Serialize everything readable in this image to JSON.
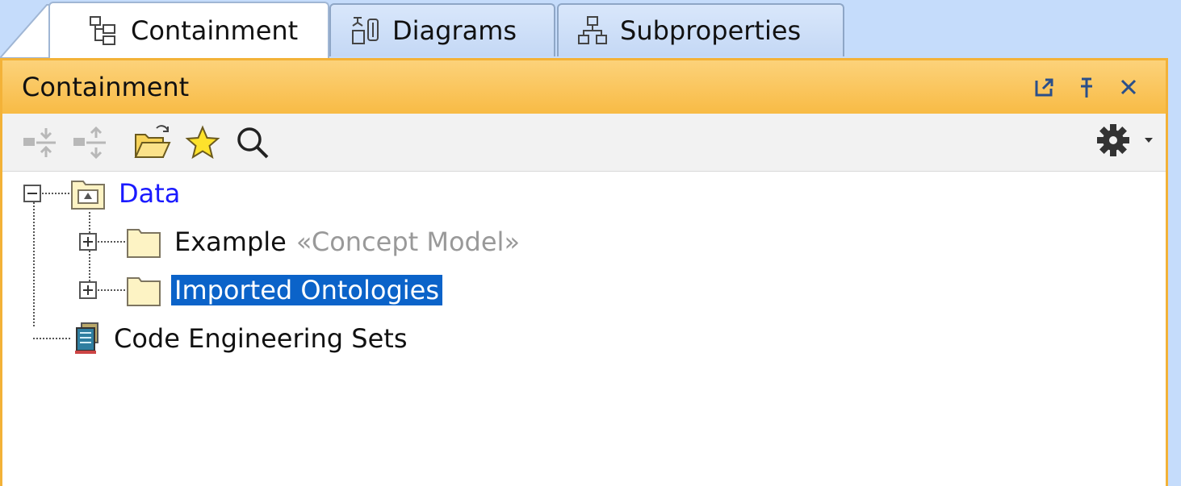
{
  "tabs": [
    {
      "label": "Containment",
      "icon": "containment-tree-icon",
      "active": true
    },
    {
      "label": "Diagrams",
      "icon": "diagram-icon",
      "active": false
    },
    {
      "label": "Subproperties",
      "icon": "hierarchy-icon",
      "active": false
    }
  ],
  "panel": {
    "title": "Containment",
    "header_controls": [
      "undock-icon",
      "pin-icon",
      "close-icon"
    ]
  },
  "toolbar": {
    "buttons": [
      "collapse-all-icon",
      "expand-all-icon",
      "open-folder-icon",
      "favorites-star-icon",
      "search-icon"
    ],
    "right": [
      "settings-gear-icon",
      "dropdown-arrow-icon"
    ]
  },
  "tree": {
    "root": {
      "label": "Data",
      "expanded": true
    },
    "children": [
      {
        "label": "Example",
        "stereotype": "«Concept Model»",
        "expanded": false
      },
      {
        "label": "Imported Ontologies",
        "expanded": false,
        "selected": true
      }
    ],
    "sibling": {
      "label": "Code Engineering Sets"
    }
  },
  "colors": {
    "accent": "#f8bb45",
    "selection": "#0b63c9",
    "link": "#1a1aff",
    "background": "#c5dcfb"
  }
}
